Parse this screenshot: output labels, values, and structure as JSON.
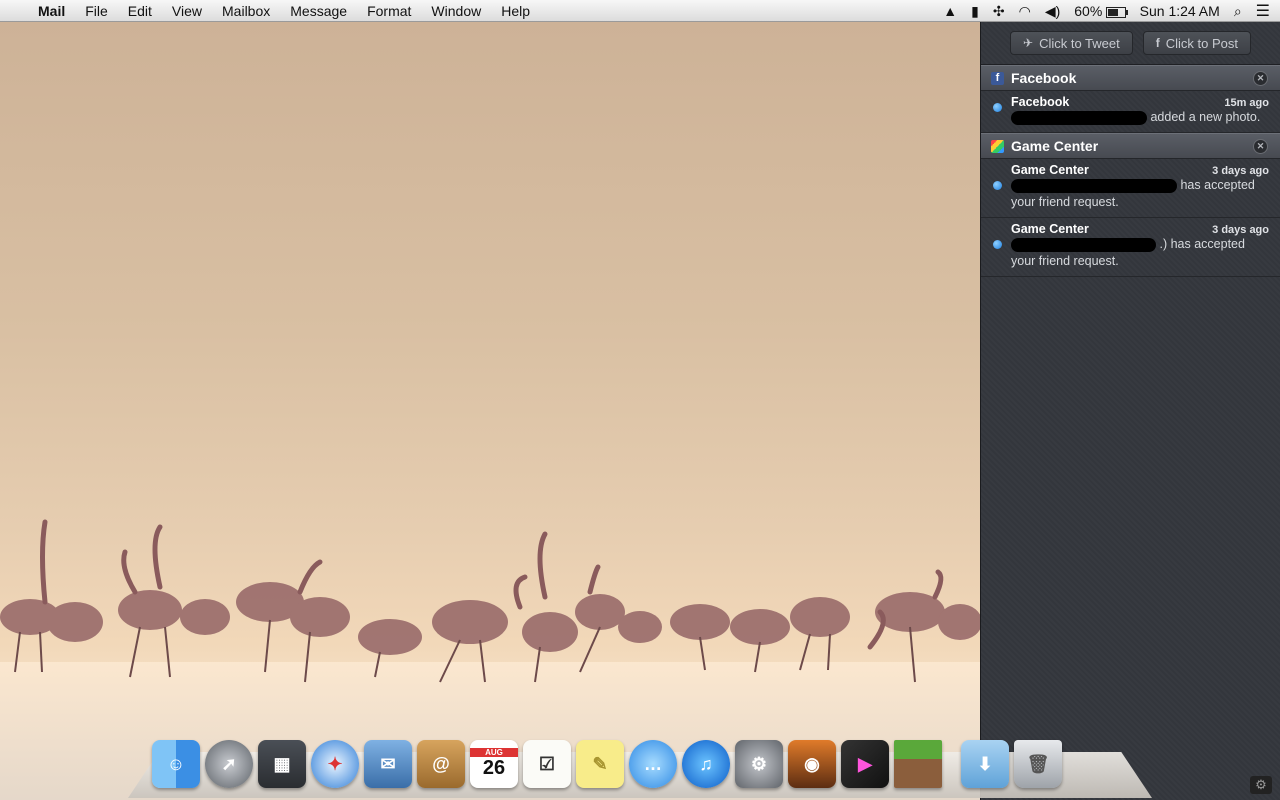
{
  "menubar": {
    "app_name": "Mail",
    "menus": [
      "File",
      "Edit",
      "View",
      "Mailbox",
      "Message",
      "Format",
      "Window",
      "Help"
    ],
    "battery_percent": "60%",
    "clock": "Sun 1:24 AM"
  },
  "notification_center": {
    "share_buttons": {
      "tweet": "Click to Tweet",
      "post": "Click to Post"
    },
    "sections": [
      {
        "app": "Facebook",
        "notifications": [
          {
            "title": "Facebook",
            "time": "15m ago",
            "body_suffix": "added a new photo."
          }
        ]
      },
      {
        "app": "Game Center",
        "notifications": [
          {
            "title": "Game Center",
            "time": "3 days ago",
            "body_suffix": "has accepted",
            "body_line2": "your friend request."
          },
          {
            "title": "Game Center",
            "time": "3 days ago",
            "body_suffix": ".) has accepted",
            "body_line2": "your friend request."
          }
        ]
      }
    ]
  },
  "dock": {
    "apps": [
      "finder-icon",
      "launchpad-icon",
      "mission-control-icon",
      "safari-icon",
      "mail-icon",
      "contacts-icon",
      "calendar-icon",
      "reminders-icon",
      "notes-icon",
      "messages-icon",
      "itunes-icon",
      "system-preferences-icon",
      "iphoto-icon",
      "final-cut-icon",
      "minecraft-icon"
    ],
    "calendar_month": "AUG",
    "calendar_day": "26"
  }
}
